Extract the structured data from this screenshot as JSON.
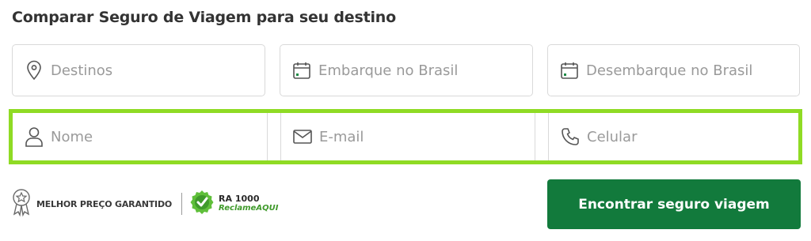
{
  "form": {
    "title": "Comparar Seguro de Viagem para seu destino",
    "fields": {
      "destinos": {
        "placeholder": "Destinos",
        "icon": "map-pin-icon"
      },
      "embarque": {
        "placeholder": "Embarque no Brasil",
        "icon": "calendar-icon"
      },
      "desembarque": {
        "placeholder": "Desembarque no Brasil",
        "icon": "calendar-icon"
      }
    },
    "contact": {
      "highlight_color": "#8fdb24",
      "nome": {
        "placeholder": "Nome",
        "icon": "user-icon"
      },
      "email": {
        "placeholder": "E-mail",
        "icon": "envelope-icon"
      },
      "celular": {
        "placeholder": "Celular",
        "icon": "phone-icon"
      }
    },
    "badges": {
      "best_price": "MELHOR PREÇO GARANTIDO",
      "ra_score": "RA 1000",
      "ra_brand": "ReclameAQUI"
    },
    "submit": {
      "label": "Encontrar seguro viagem",
      "color": "#127a3c"
    }
  }
}
